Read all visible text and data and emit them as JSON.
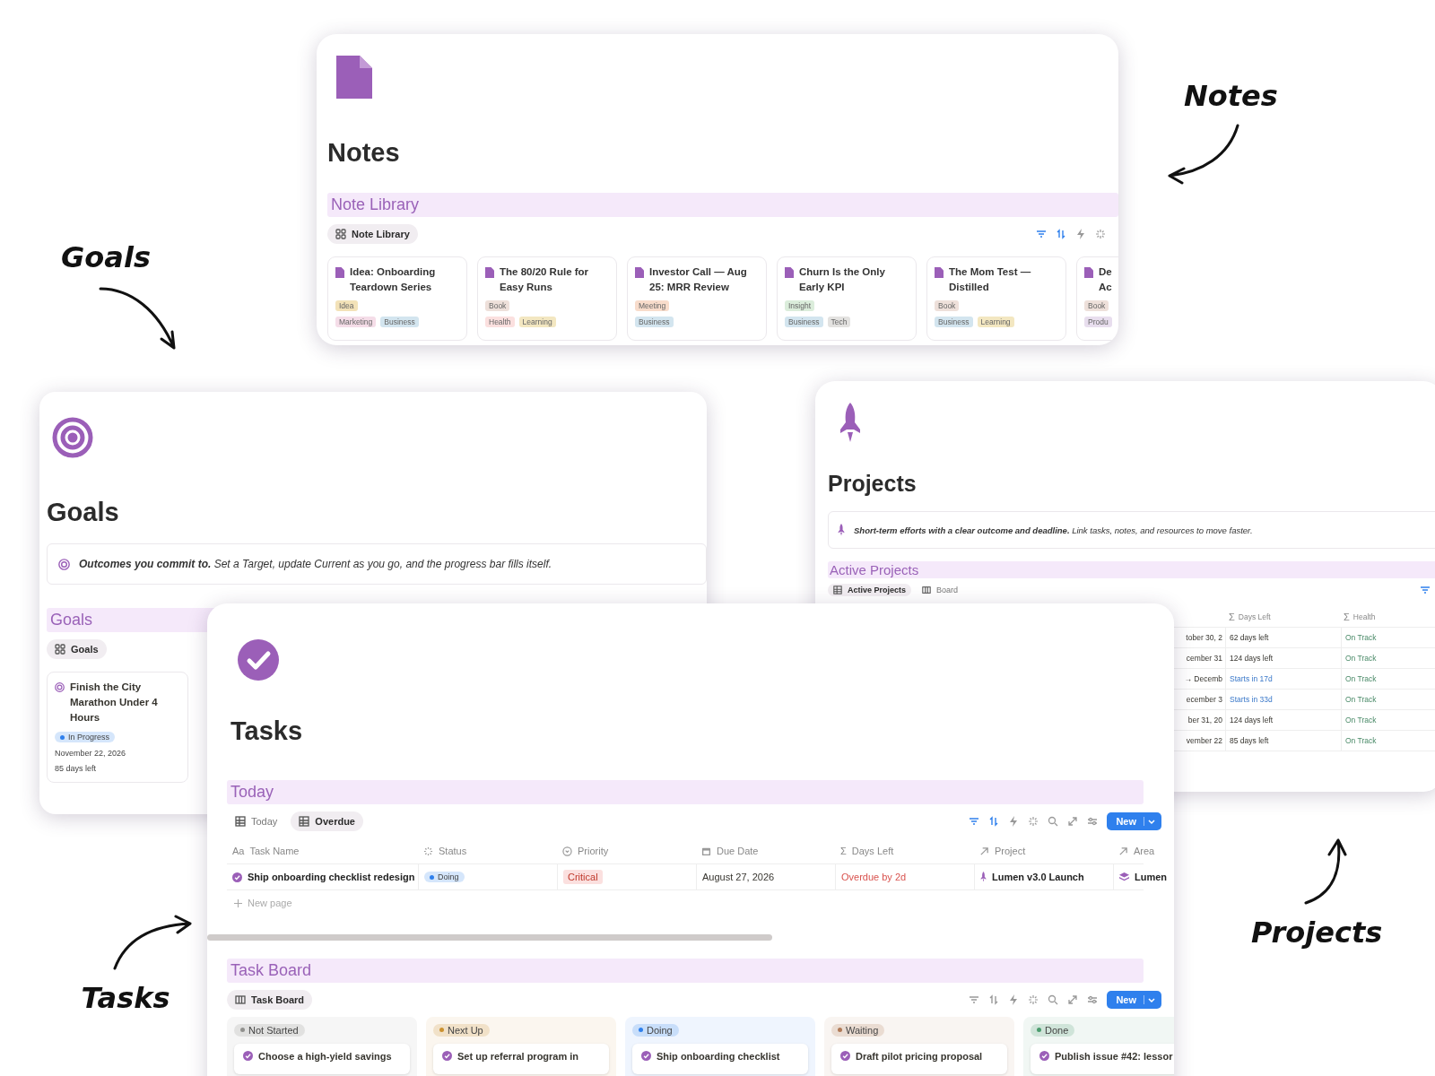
{
  "callouts": [
    {
      "label": "Notes"
    },
    {
      "label": "Goals"
    },
    {
      "label": "Projects"
    },
    {
      "label": "Tasks"
    }
  ],
  "notes": {
    "title": "Notes",
    "section": "Note Library",
    "views": [
      {
        "label": "Note Library",
        "selected": true
      }
    ],
    "cards": [
      {
        "title": "Idea: Onboarding Teardown Series",
        "type": {
          "label": "Idea",
          "color": "#f3e2b8"
        },
        "areas": [
          {
            "label": "Marketing",
            "color": "#f5dde8"
          },
          {
            "label": "Business",
            "color": "#d3e5ef"
          }
        ]
      },
      {
        "title": "The 80/20 Rule for Easy Runs",
        "type": {
          "label": "Book",
          "color": "#eee0da"
        },
        "areas": [
          {
            "label": "Health",
            "color": "#fbe0df"
          },
          {
            "label": "Learning",
            "color": "#f3e7c1"
          }
        ]
      },
      {
        "title": "Investor Call — Aug 25: MRR Review",
        "type": {
          "label": "Meeting",
          "color": "#f8dccb"
        },
        "areas": [
          {
            "label": "Business",
            "color": "#d3e5ef"
          }
        ]
      },
      {
        "title": "Churn Is the Only Early KPI",
        "type": {
          "label": "Insight",
          "color": "#dbeddb"
        },
        "areas": [
          {
            "label": "Business",
            "color": "#d3e5ef"
          },
          {
            "label": "Tech",
            "color": "#e3e2e0"
          }
        ]
      },
      {
        "title": "The Mom Test — Distilled",
        "type": {
          "label": "Book",
          "color": "#eee0da"
        },
        "areas": [
          {
            "label": "Business",
            "color": "#d3e5ef"
          },
          {
            "label": "Learning",
            "color": "#f3e7c1"
          }
        ]
      },
      {
        "title": "De\nAc",
        "type": {
          "label": "Book",
          "color": "#eee0da"
        },
        "areas": [
          {
            "label": "Produ",
            "color": "#e8deee"
          }
        ]
      }
    ]
  },
  "goals": {
    "title": "Goals",
    "callout": "**Outcomes you commit to.** Set a Target, update Current as you go, and the progress bar fills itself.",
    "section": "Goals",
    "views": [
      {
        "label": "Goals",
        "selected": true
      }
    ],
    "cards": [
      {
        "title": "Finish the City Marathon Under 4 Hours",
        "status": {
          "label": "In Progress",
          "color": "#2f80ed"
        },
        "date": "November 22, 2026",
        "days_left": "85 days left"
      }
    ]
  },
  "projects": {
    "title": "Projects",
    "callout": "**Short-term efforts with a clear outcome and deadline.** Link tasks, notes, and resources to move faster.",
    "section": "Active Projects",
    "views": [
      {
        "label": "Active Projects",
        "selected": true,
        "kind": "table"
      },
      {
        "label": "Board",
        "selected": false,
        "kind": "board"
      }
    ],
    "columns": [
      {
        "label": "Days Left",
        "glyph": "Σ"
      },
      {
        "label": "Health",
        "glyph": "Σ"
      }
    ],
    "rows": [
      {
        "date": "tober 30, 2",
        "days_left": "62 days left",
        "upcoming": false,
        "health": "On Track"
      },
      {
        "date": "cember 31",
        "days_left": "124 days left",
        "upcoming": false,
        "health": "On Track"
      },
      {
        "date": "→ Decemb",
        "days_left": "Starts in 17d",
        "upcoming": true,
        "health": "On Track"
      },
      {
        "date": "ecember 3",
        "days_left": "Starts in 33d",
        "upcoming": true,
        "health": "On Track"
      },
      {
        "date": "ber 31, 20",
        "days_left": "124 days left",
        "upcoming": false,
        "health": "On Track"
      },
      {
        "date": "vember 22",
        "days_left": "85 days left",
        "upcoming": false,
        "health": "On Track"
      }
    ]
  },
  "tasks": {
    "title": "Tasks",
    "today": {
      "title": "Today",
      "views": [
        {
          "label": "Today",
          "selected": false
        },
        {
          "label": "Overdue",
          "selected": true
        }
      ],
      "new_button": "New",
      "columns": [
        {
          "label": "Task Name",
          "kind": "title",
          "glyph": "Aa"
        },
        {
          "label": "Status",
          "kind": "status"
        },
        {
          "label": "Priority",
          "kind": "select"
        },
        {
          "label": "Due Date",
          "kind": "date"
        },
        {
          "label": "Days Left",
          "kind": "formula",
          "glyph": "Σ"
        },
        {
          "label": "Project",
          "kind": "relation"
        },
        {
          "label": "Area",
          "kind": "relation"
        }
      ],
      "rows": [
        {
          "task": "Ship onboarding checklist redesign",
          "status": {
            "label": "Doing",
            "color": "#2f80ed"
          },
          "priority": "Critical",
          "due": "August 27, 2026",
          "days_left": "Overdue by 2d",
          "overdue": true,
          "project": "Lumen v3.0 Launch",
          "area": "Lumen"
        }
      ],
      "new_page": "New page"
    },
    "board": {
      "title": "Task Board",
      "views": [
        {
          "label": "Task Board",
          "selected": true
        }
      ],
      "new_button": "New",
      "groups": [
        {
          "label": "Not Started",
          "color": "#91918e",
          "cards": [
            "Choose a high-yield savings"
          ]
        },
        {
          "label": "Next Up",
          "color": "#cb912f",
          "cards": [
            "Set up referral program in"
          ]
        },
        {
          "label": "Doing",
          "color": "#2f80ed",
          "cards": [
            "Ship onboarding checklist"
          ]
        },
        {
          "label": "Waiting",
          "color": "#b07a57",
          "cards": [
            "Draft pilot pricing proposal"
          ]
        },
        {
          "label": "Done",
          "color": "#4a9c6d",
          "cards": [
            "Publish issue #42: lessor"
          ]
        }
      ]
    }
  }
}
